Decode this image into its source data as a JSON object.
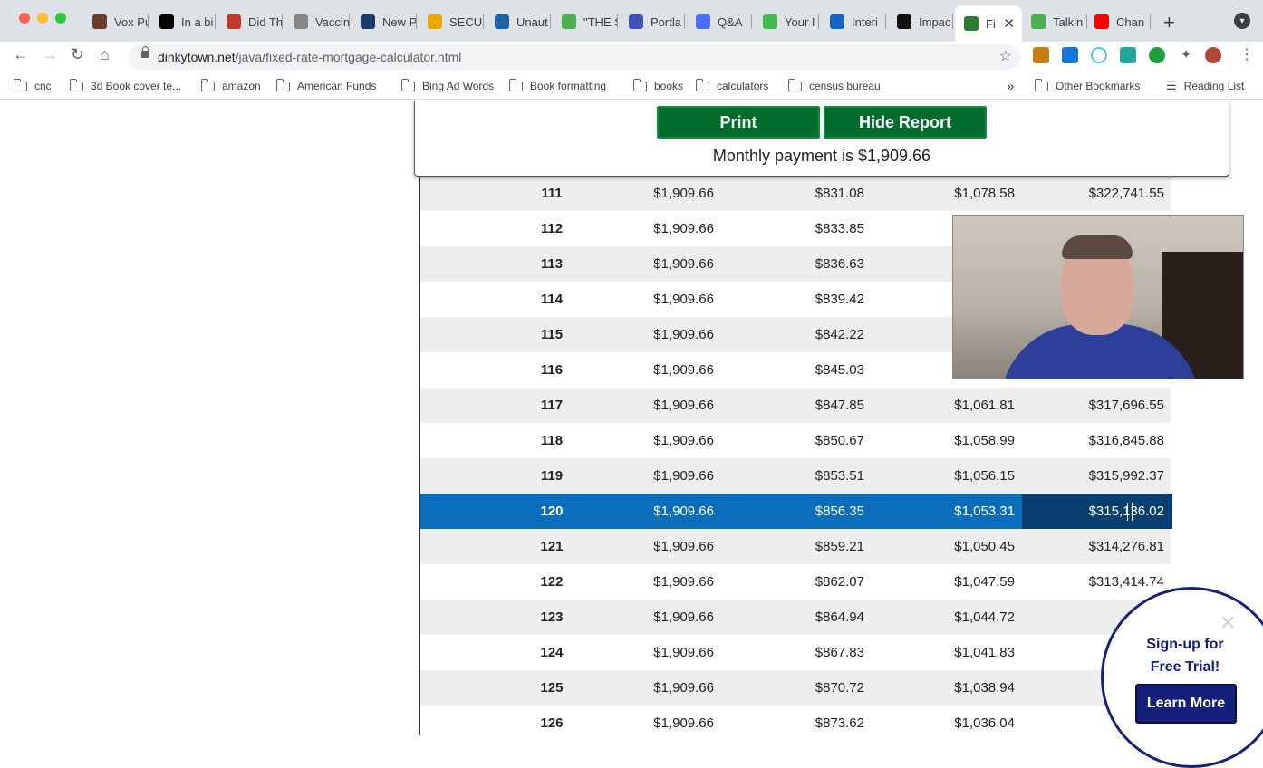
{
  "browser": {
    "tabs": [
      {
        "label": "Vox Pu",
        "fav_color": "#6b3d2e",
        "left": 0
      },
      {
        "label": "In a bi",
        "fav_color": "#000000"
      },
      {
        "label": "Did Th",
        "fav_color": "#c0392b"
      },
      {
        "label": "Vaccin",
        "fav_color": "#888888"
      },
      {
        "label": "New P",
        "fav_color": "#1a3a6b"
      },
      {
        "label": "SECU",
        "fav_color": "#e8a600"
      },
      {
        "label": "Unaut",
        "fav_color": "#1f5fa8"
      },
      {
        "label": "\"THE S",
        "fav_color": "#4caf50"
      },
      {
        "label": "Portla",
        "fav_color": "#3f51b5"
      },
      {
        "label": "Q&A",
        "fav_color": "#4a6cf7"
      },
      {
        "label": "Your I",
        "fav_color": "#3fb950"
      },
      {
        "label": "Interi",
        "fav_color": "#1565c0"
      },
      {
        "label": "Impac",
        "fav_color": "#111111"
      },
      {
        "label": "Fi",
        "fav_color": "#2e7d32"
      },
      {
        "label": "Talkin",
        "fav_color": "#4caf50"
      },
      {
        "label": "Chan",
        "fav_color": "#ff0000"
      }
    ],
    "active_tab_close": "✕",
    "new_tab": "+",
    "url_domain": "dinkytown.net",
    "url_path": "/java/fixed-rate-mortgage-calculator.html",
    "bookmarks": [
      "cnc",
      "3d Book cover te...",
      "amazon",
      "American Funds",
      "Bing Ad Words",
      "Book formatting",
      "books",
      "calculators",
      "census bureau"
    ],
    "bookmarks_overflow": "»",
    "other_bookmarks": "Other Bookmarks",
    "reading_list": "Reading List"
  },
  "report": {
    "print_label": "Print",
    "hide_label": "Hide Report",
    "monthly_payment": "Monthly payment is $1,909.66"
  },
  "table": {
    "highlighted_row": 120,
    "rows": [
      [
        "111",
        "$1,909.66",
        "$831.08",
        "$1,078.58",
        "$322,741.55"
      ],
      [
        "112",
        "$1,909.66",
        "$833.85",
        "",
        ""
      ],
      [
        "113",
        "$1,909.66",
        "$836.63",
        "",
        ""
      ],
      [
        "114",
        "$1,909.66",
        "$839.42",
        "",
        ""
      ],
      [
        "115",
        "$1,909.66",
        "$842.22",
        "",
        ""
      ],
      [
        "116",
        "$1,909.66",
        "$845.03",
        "",
        ""
      ],
      [
        "117",
        "$1,909.66",
        "$847.85",
        "$1,061.81",
        "$317,696.55"
      ],
      [
        "118",
        "$1,909.66",
        "$850.67",
        "$1,058.99",
        "$316,845.88"
      ],
      [
        "119",
        "$1,909.66",
        "$853.51",
        "$1,056.15",
        "$315,992.37"
      ],
      [
        "120",
        "$1,909.66",
        "$856.35",
        "$1,053.31",
        "$315,136.02"
      ],
      [
        "121",
        "$1,909.66",
        "$859.21",
        "$1,050.45",
        "$314,276.81"
      ],
      [
        "122",
        "$1,909.66",
        "$862.07",
        "$1,047.59",
        "$313,414.74"
      ],
      [
        "123",
        "$1,909.66",
        "$864.94",
        "$1,044.72",
        "$312,"
      ],
      [
        "124",
        "$1,909.66",
        "$867.83",
        "$1,041.83",
        "$3"
      ],
      [
        "125",
        "$1,909.66",
        "$870.72",
        "$1,038.94",
        "$3"
      ],
      [
        "126",
        "$1,909.66",
        "$873.62",
        "$1,036.04",
        "$309,"
      ]
    ]
  },
  "promo": {
    "close": "✕",
    "title": "Sign-up for Free Trial!",
    "button": "Learn More"
  },
  "colors": {
    "button_green": "#006d2c",
    "highlight_blue": "#0a6ebd",
    "promo_navy": "#14207a"
  }
}
